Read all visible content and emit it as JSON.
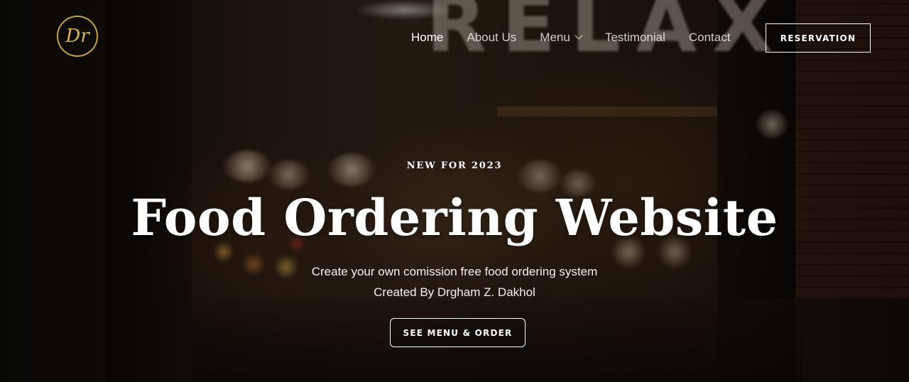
{
  "header": {
    "logo_text": "Dr",
    "nav": [
      {
        "label": "Home",
        "active": true
      },
      {
        "label": "About Us",
        "active": false
      },
      {
        "label": "Menu",
        "active": false,
        "has_dropdown": true
      },
      {
        "label": "Testimonial",
        "active": false
      },
      {
        "label": "Contact",
        "active": false
      }
    ],
    "reservation_label": "RESERVATION"
  },
  "hero": {
    "eyebrow": "NEW FOR 2023",
    "title": "Food Ordering Website",
    "subtitle_line1": "Create your own comission free food ordering system",
    "subtitle_line2": "Created By Drgham Z. Dakhol",
    "cta_label": "SEE MENU & ORDER",
    "background_sign_text": "RELAX"
  },
  "colors": {
    "logo_gold": "#c9a34a",
    "text_white": "#ffffff",
    "background_dark": "#120d09"
  },
  "icons": {
    "menu_dropdown": "chevron-down-icon"
  }
}
